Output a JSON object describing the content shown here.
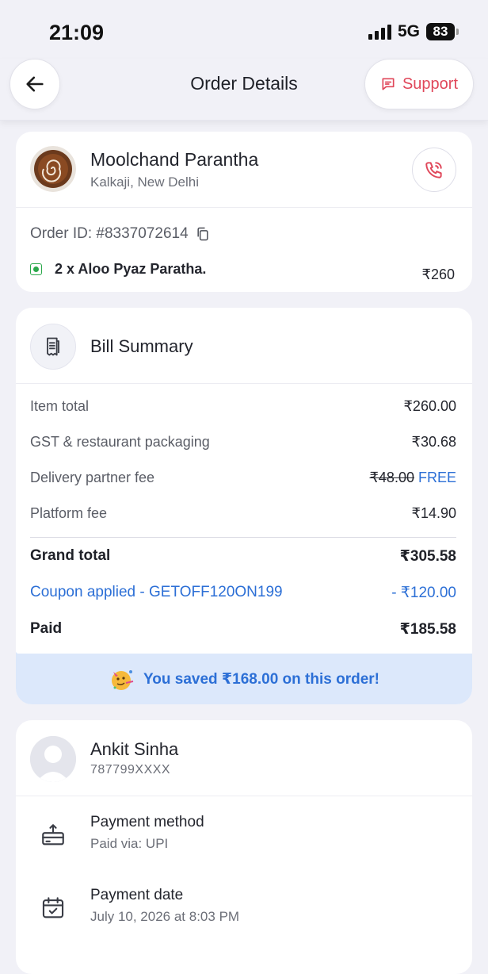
{
  "status_bar": {
    "time": "21:09",
    "network": "5G",
    "battery": "83"
  },
  "header": {
    "title": "Order Details",
    "support_label": "Support"
  },
  "restaurant": {
    "name": "Moolchand Parantha",
    "location": "Kalkaji, New Delhi",
    "order_id": "Order ID: #8337072614",
    "item": "2 x Aloo Pyaz Paratha.",
    "item_price": "₹260"
  },
  "bill": {
    "title": "Bill Summary",
    "item_total_label": "Item total",
    "item_total": "₹260.00",
    "gst_label": "GST & restaurant packaging",
    "gst": "₹30.68",
    "delivery_label": "Delivery partner fee",
    "delivery_original": "₹48.00",
    "delivery_free": "FREE",
    "platform_label": "Platform fee",
    "platform": "₹14.90",
    "grand_total_label": "Grand total",
    "grand_total": "₹305.58",
    "coupon_label": "Coupon applied - GETOFF120ON199",
    "coupon_value": "- ₹120.00",
    "paid_label": "Paid",
    "paid": "₹185.58",
    "saved_text": "You saved ₹168.00 on this order!"
  },
  "customer": {
    "name": "Ankit Sinha",
    "phone": "787799XXXX",
    "payment_method_label": "Payment method",
    "payment_method": "Paid via: UPI",
    "payment_date_label": "Payment date",
    "payment_date": "July 10, 2026 at 8:03 PM"
  },
  "colors": {
    "accent_red": "#e0475a",
    "accent_blue": "#2c6fd6",
    "veg_green": "#2aa84a"
  }
}
